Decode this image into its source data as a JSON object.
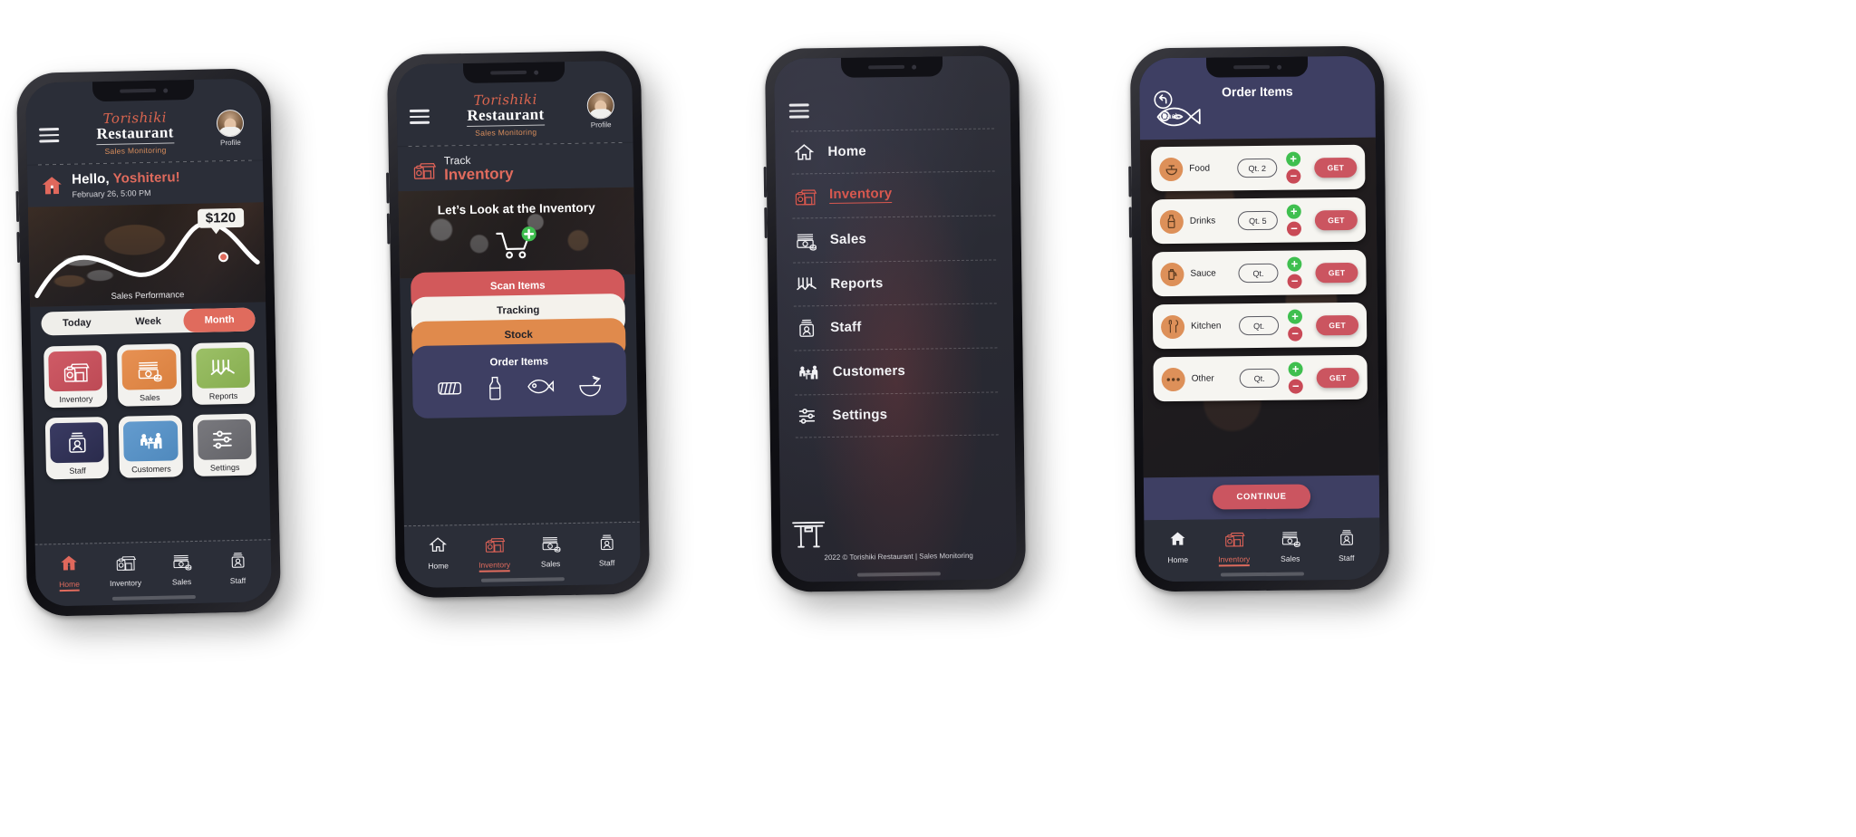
{
  "brand": {
    "script": "Torishiki",
    "name": "Restaurant",
    "tagline": "Sales Monitoring",
    "profile_label": "Profile"
  },
  "colors": {
    "accent_red": "#e06b5d",
    "card_red": "#d2595b",
    "card_orange": "#e08a4c",
    "card_cream": "#f4f2ec",
    "card_navy": "#3e3f63",
    "green": "#3fbf4f",
    "panel": "#2b2e38"
  },
  "screen_home": {
    "greeting_prefix": "Hello,",
    "user_name": "Yoshiteru!",
    "datetime": "February 26, 5:00 PM",
    "home_icon": "house-icon",
    "value_bubble": "$120",
    "chart_caption": "Sales Performance",
    "segments": [
      {
        "label": "Today",
        "active": false
      },
      {
        "label": "Week",
        "active": false
      },
      {
        "label": "Month",
        "active": true
      }
    ],
    "tiles": [
      {
        "label": "Inventory",
        "icon": "storefront-clipboard-icon",
        "color": "#c85561"
      },
      {
        "label": "Sales",
        "icon": "money-cash-icon",
        "color": "#e08a4c"
      },
      {
        "label": "Reports",
        "icon": "bar-chart-icon",
        "color": "#93b95c"
      },
      {
        "label": "Staff",
        "icon": "id-badge-icon",
        "color": "#313257"
      },
      {
        "label": "Customers",
        "icon": "customer-service-icon",
        "color": "#5b93c9"
      },
      {
        "label": "Settings",
        "icon": "sliders-icon",
        "color": "#6d6d72"
      }
    ],
    "tabs": [
      {
        "label": "Home",
        "icon": "house-icon",
        "active": true
      },
      {
        "label": "Inventory",
        "icon": "storefront-clipboard-icon",
        "active": false
      },
      {
        "label": "Sales",
        "icon": "money-cash-icon",
        "active": false
      },
      {
        "label": "Staff",
        "icon": "id-badge-icon",
        "active": false
      }
    ]
  },
  "screen_inventory": {
    "track_kicker": "Track",
    "track_title": "Inventory",
    "track_icon": "storefront-clipboard-icon",
    "hero_title": "Let’s Look at the Inventory",
    "hero_icon": "cart-plus-icon",
    "cards": [
      {
        "label": "Scan Items",
        "style": "red"
      },
      {
        "label": "Tracking",
        "style": "cream"
      },
      {
        "label": "Stock",
        "style": "orange"
      },
      {
        "label": "Order Items",
        "style": "navy"
      }
    ],
    "order_icons": [
      "sushi-roll-icon",
      "bottle-icon",
      "fish-icon",
      "noodle-bowl-icon"
    ],
    "tabs": [
      {
        "label": "Home",
        "icon": "house-icon",
        "active": false
      },
      {
        "label": "Inventory",
        "icon": "storefront-clipboard-icon",
        "active": true
      },
      {
        "label": "Sales",
        "icon": "money-cash-icon",
        "active": false
      },
      {
        "label": "Staff",
        "icon": "id-badge-icon",
        "active": false
      }
    ]
  },
  "screen_menu": {
    "items": [
      {
        "label": "Home",
        "icon": "house-icon",
        "active": false
      },
      {
        "label": "Inventory",
        "icon": "storefront-clipboard-icon",
        "active": true
      },
      {
        "label": "Sales",
        "icon": "money-cash-icon",
        "active": false
      },
      {
        "label": "Reports",
        "icon": "bar-chart-icon",
        "active": false
      },
      {
        "label": "Staff",
        "icon": "id-badge-icon",
        "active": false
      },
      {
        "label": "Customers",
        "icon": "customer-service-icon",
        "active": false
      },
      {
        "label": "Settings",
        "icon": "sliders-icon",
        "active": false
      }
    ],
    "footer_icon": "torii-gate-icon",
    "copyright": "2022 © Torishiki Restaurant | Sales Monitoring"
  },
  "screen_order": {
    "title": "Order Items",
    "back_label": "Back",
    "back_icon": "back-arrow-icon",
    "header_icon": "fish-icon",
    "qty_placeholder": "Qt.",
    "get_label": "GET",
    "continue_label": "CONTINUE",
    "rows": [
      {
        "name": "Food",
        "icon": "mortar-bowl-icon",
        "qty": "Qt. 2"
      },
      {
        "name": "Drinks",
        "icon": "bottle-icon",
        "qty": "Qt. 5"
      },
      {
        "name": "Sauce",
        "icon": "sauce-jug-icon",
        "qty": "Qt."
      },
      {
        "name": "Kitchen",
        "icon": "utensils-icon",
        "qty": "Qt."
      },
      {
        "name": "Other",
        "icon": "ellipsis-icon",
        "qty": "Qt."
      }
    ],
    "tabs": [
      {
        "label": "Home",
        "icon": "house-icon",
        "active": false
      },
      {
        "label": "Inventory",
        "icon": "storefront-clipboard-icon",
        "active": true
      },
      {
        "label": "Sales",
        "icon": "money-cash-icon",
        "active": false
      },
      {
        "label": "Staff",
        "icon": "id-badge-icon",
        "active": false
      }
    ]
  },
  "chart_data": {
    "type": "line",
    "title": "Sales Performance",
    "x": [
      0,
      1,
      2,
      3,
      4,
      5,
      6
    ],
    "values": [
      8,
      46,
      52,
      40,
      38,
      96,
      70
    ],
    "annotation": {
      "label": "$120",
      "x": 5,
      "y": 96
    },
    "xlabel": "",
    "ylabel": "",
    "grid": false,
    "legend": false,
    "range_selected": "Month",
    "ranges": [
      "Today",
      "Week",
      "Month"
    ]
  }
}
